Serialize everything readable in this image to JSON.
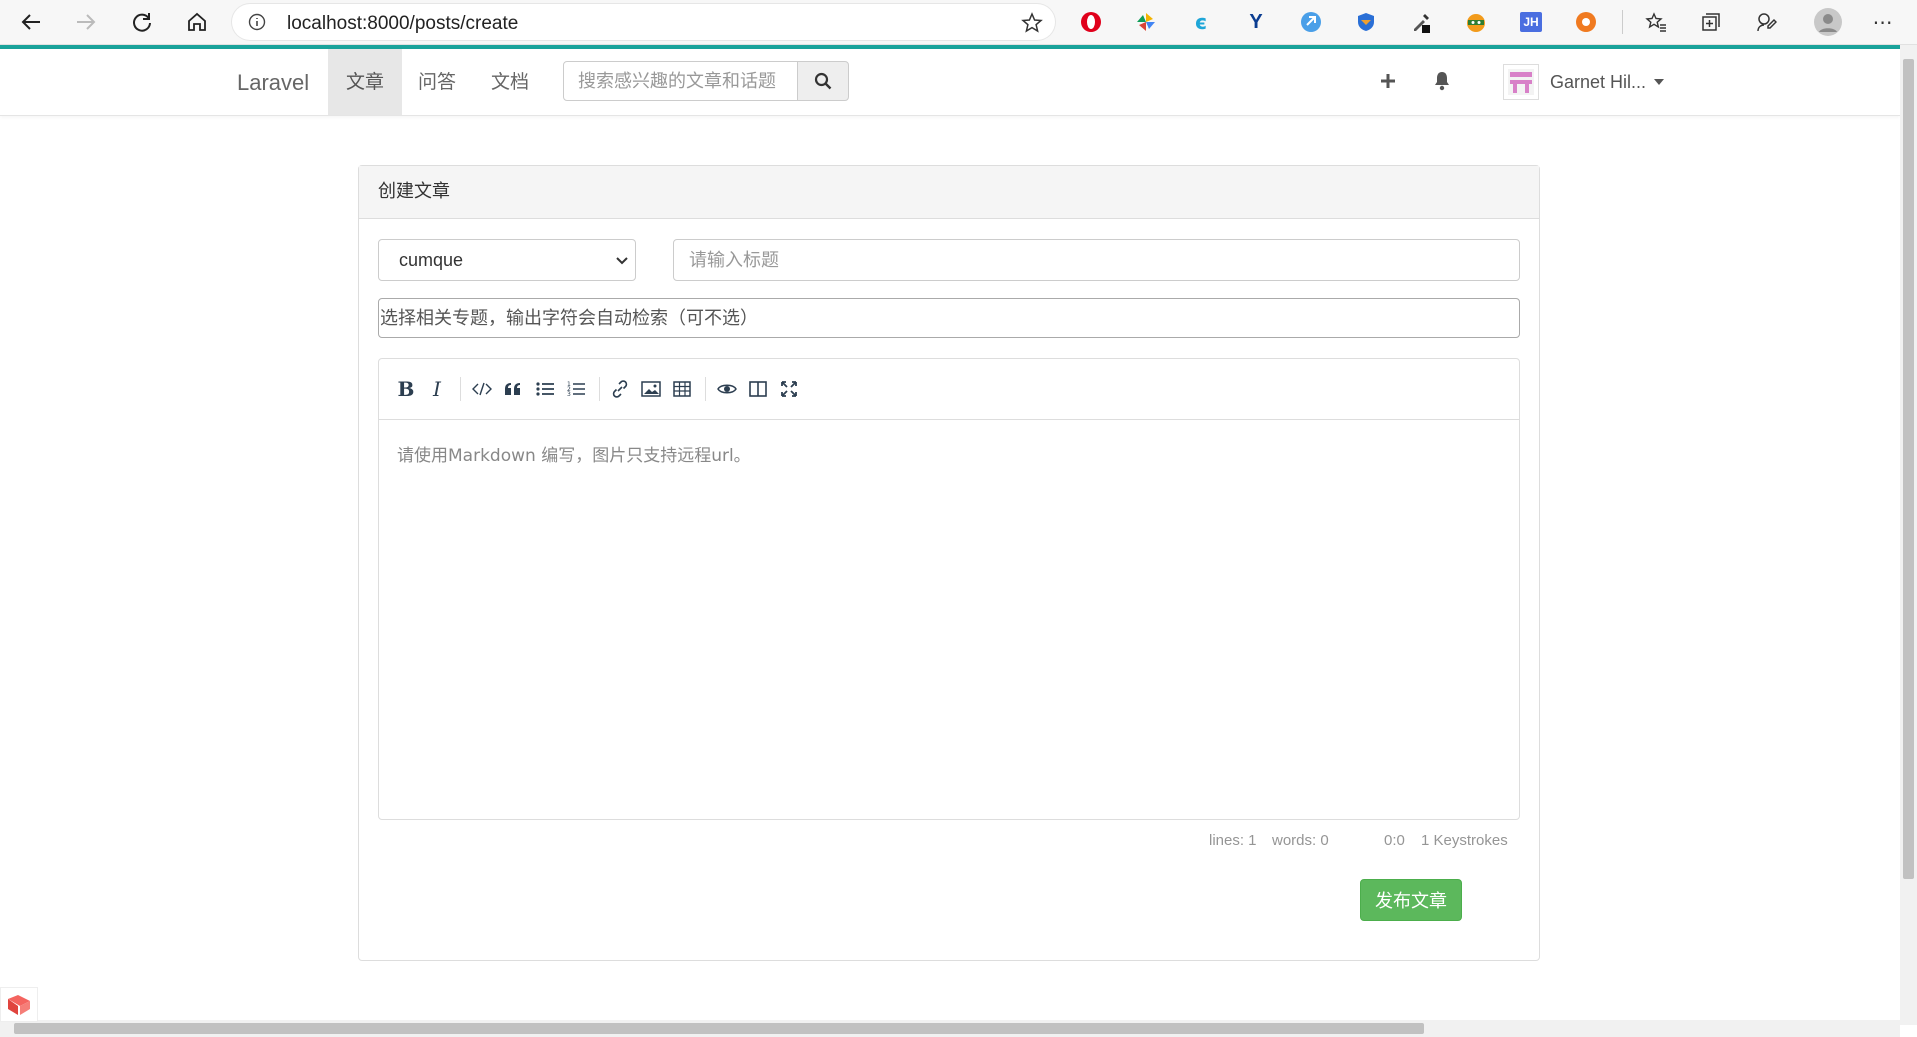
{
  "browser": {
    "url": "localhost:8000/posts/create",
    "extensions": [
      "opera-icon",
      "pinwheel-icon",
      "e-icon",
      "v-icon",
      "arrow-icon",
      "shield-icon",
      "eyedropper-icon",
      "ninja-icon",
      "jh-icon",
      "orange-icon"
    ],
    "jh_label": "JH"
  },
  "navbar": {
    "brand": "Laravel",
    "items": [
      "文章",
      "问答",
      "文档"
    ],
    "active_item": "文章",
    "search_placeholder": "搜索感兴趣的文章和话题",
    "username": "Garnet Hil..."
  },
  "panel": {
    "heading": "创建文章",
    "category_selected": "cumque",
    "title_placeholder": "请输入标题",
    "topic_placeholder": "选择相关专题，输出字符会自动检索（可不选）",
    "editor_placeholder": "请使用Markdown 编写，图片只支持远程url。",
    "toolbar": [
      "bold",
      "italic",
      "code",
      "quote",
      "unordered-list",
      "ordered-list",
      "link",
      "image",
      "table",
      "preview",
      "side-by-side",
      "fullscreen"
    ],
    "bold_label": "B",
    "italic_label": "I",
    "status": {
      "lines": "lines: 1",
      "words": "words: 0",
      "cursor": "0:0",
      "keystrokes": "1 Keystrokes"
    },
    "publish_label": "发布文章"
  },
  "colors": {
    "accent_line": "#1aa39b",
    "publish_button": "#5cb85c"
  }
}
